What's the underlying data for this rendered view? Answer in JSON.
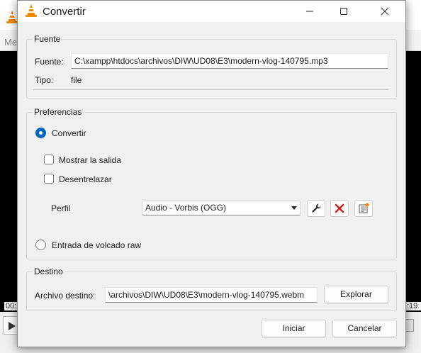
{
  "background": {
    "menu_text": "Me",
    "time_elapsed": "00:",
    "time_total": ":19"
  },
  "dialog": {
    "title": "Convertir",
    "source_group": {
      "title": "Fuente",
      "source_label": "Fuente:",
      "source_value": "C:\\xampp\\htdocs\\archivos\\DIW\\UD08\\E3\\modern-vlog-140795.mp3",
      "type_label": "Tipo:",
      "type_value": "file"
    },
    "prefs_group": {
      "title": "Preferencias",
      "convert_label": "Convertir",
      "convert_checked": true,
      "show_output_label": "Mostrar la salida",
      "show_output_checked": false,
      "deinterlace_label": "Desentrelazar",
      "deinterlace_checked": false,
      "profile_label": "Perfil",
      "profile_selected": "Audio - Vorbis (OGG)",
      "raw_dump_label": "Entrada de volcado raw",
      "raw_dump_checked": false
    },
    "dest_group": {
      "title": "Destino",
      "dest_label": "Archivo destino:",
      "dest_value": "\\archivos\\DIW\\UD08\\E3\\modern-vlog-140795.webm",
      "browse_label": "Explorar"
    },
    "start_label": "Iniciar",
    "cancel_label": "Cancelar"
  },
  "colors": {
    "accent": "#0067c0",
    "delete_red": "#d42020",
    "vlc_orange": "#f08a00"
  },
  "icons": [
    "vlc-cone-icon",
    "minimize-icon",
    "maximize-icon",
    "close-icon",
    "wrench-icon",
    "delete-icon",
    "new-profile-icon",
    "play-icon"
  ]
}
